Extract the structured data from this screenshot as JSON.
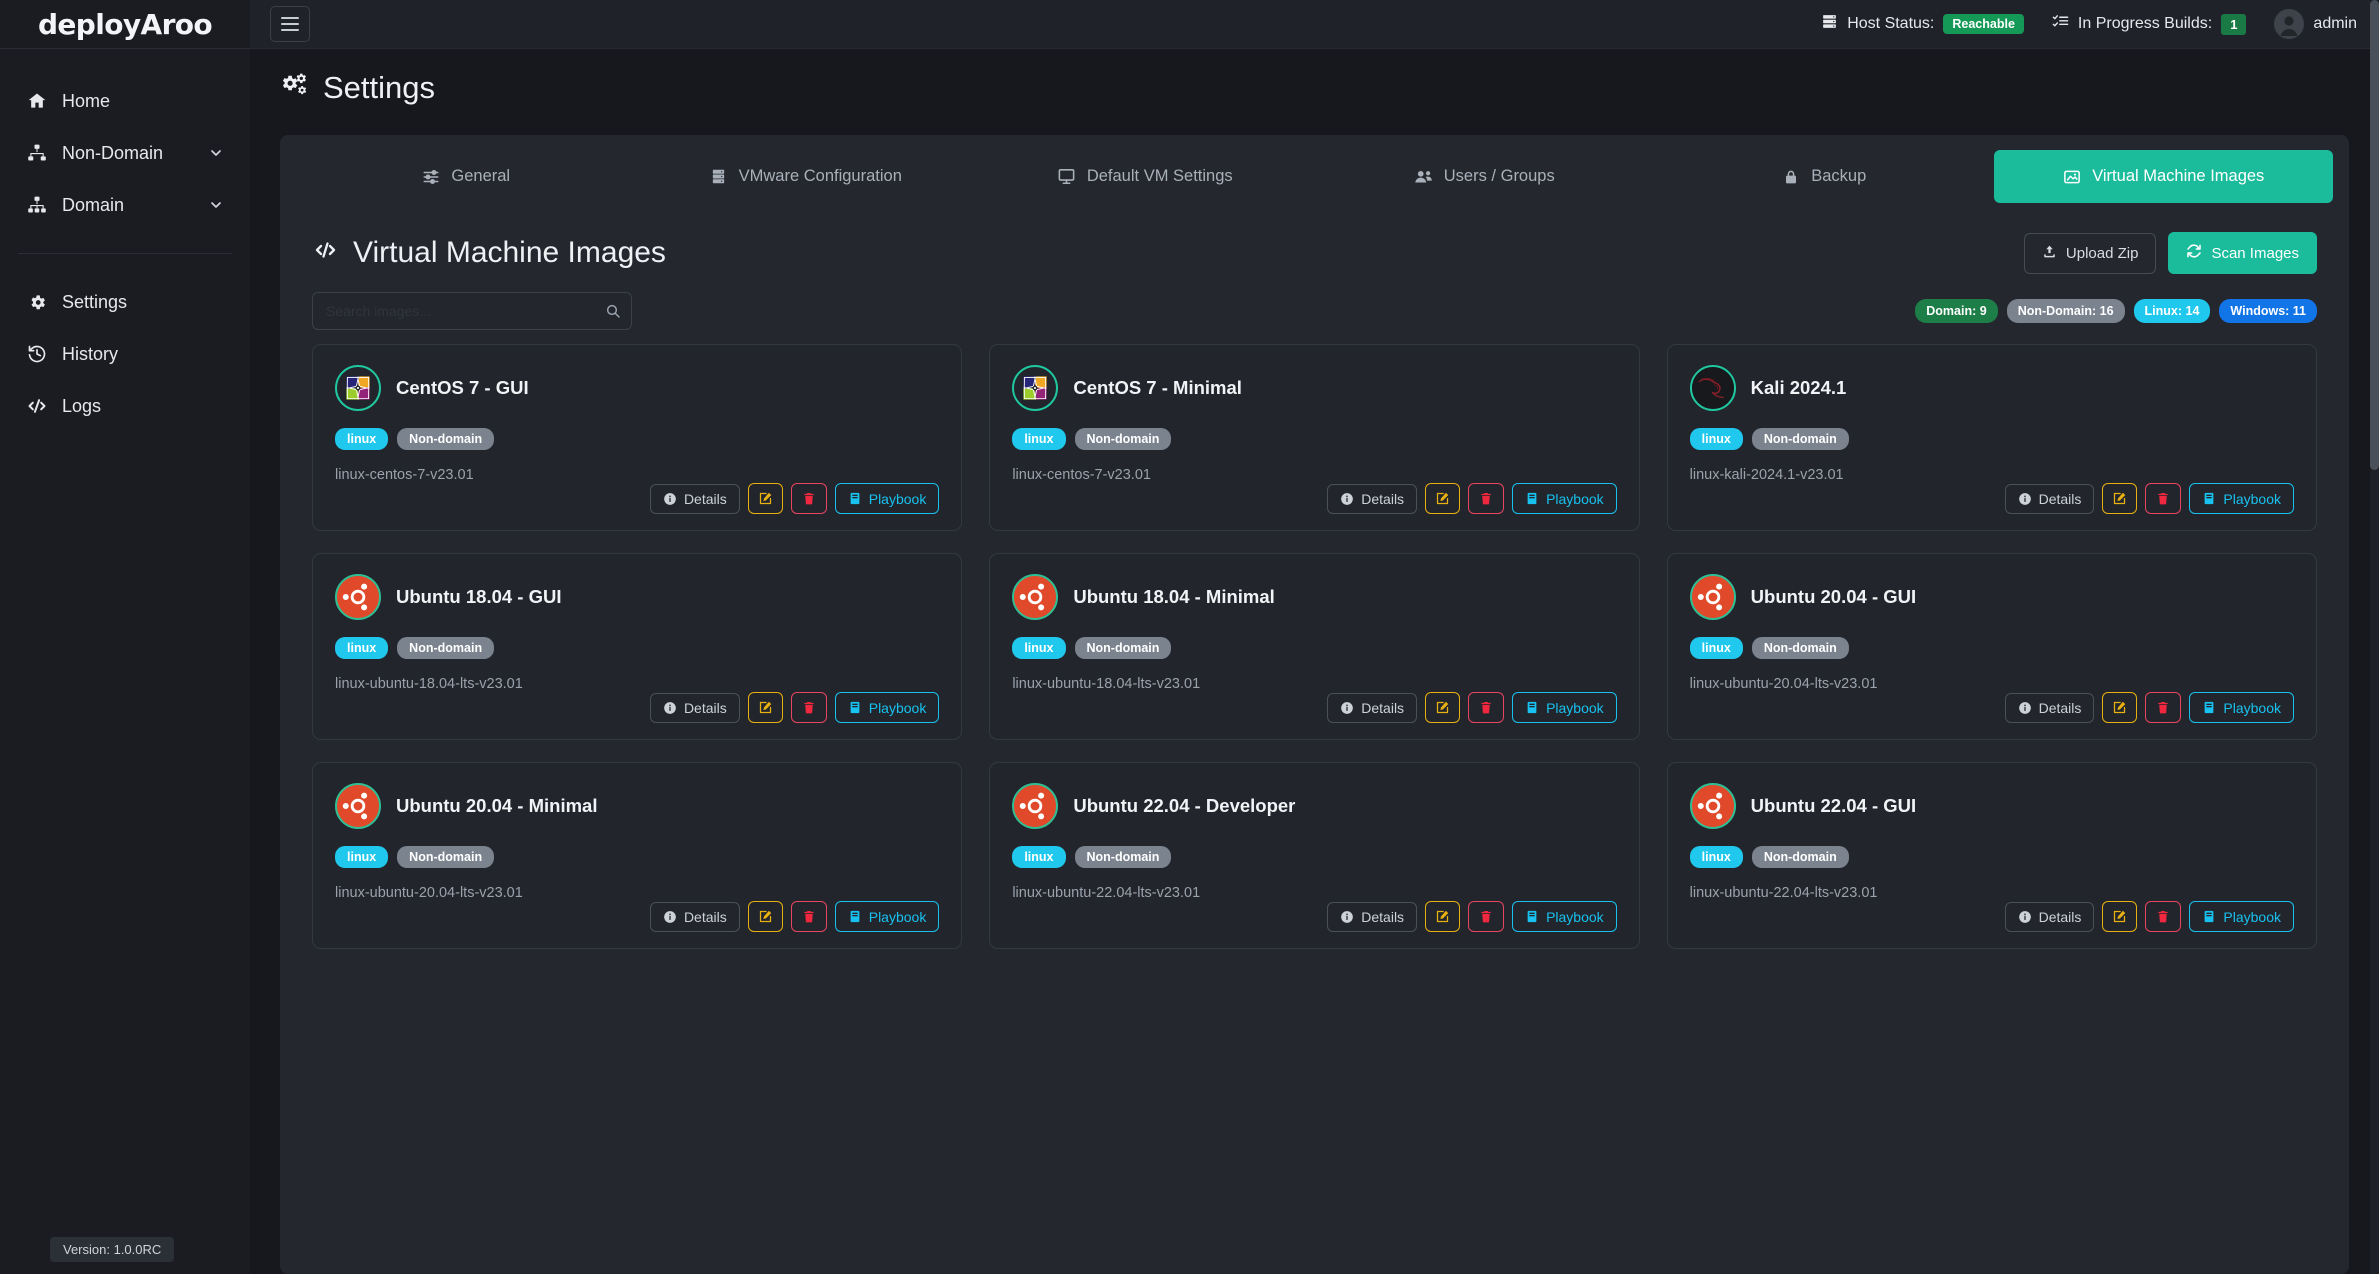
{
  "brand": {
    "name": "deployAroo"
  },
  "sidebar": {
    "items": [
      {
        "label": "Home",
        "icon": "home-icon",
        "expandable": false
      },
      {
        "label": "Non-Domain",
        "icon": "sitemap-icon",
        "expandable": true
      },
      {
        "label": "Domain",
        "icon": "sitemap-icon",
        "expandable": true
      }
    ],
    "items2": [
      {
        "label": "Settings",
        "icon": "gear-icon"
      },
      {
        "label": "History",
        "icon": "history-icon"
      },
      {
        "label": "Logs",
        "icon": "code-icon"
      }
    ],
    "version": "Version: 1.0.0RC"
  },
  "topbar": {
    "menu_icon": "hamburger-icon",
    "host_status_label": "Host Status:",
    "host_status_value": "Reachable",
    "builds_label": "In Progress Builds:",
    "builds_count": "1",
    "user": "admin"
  },
  "page": {
    "title": "Settings",
    "icon": "gears-icon"
  },
  "tabs": [
    {
      "label": "General",
      "icon": "sliders-icon",
      "active": false
    },
    {
      "label": "VMware Configuration",
      "icon": "server-icon",
      "active": false
    },
    {
      "label": "Default VM Settings",
      "icon": "desktop-icon",
      "active": false
    },
    {
      "label": "Users / Groups",
      "icon": "users-icon",
      "active": false
    },
    {
      "label": "Backup",
      "icon": "lock-icon",
      "active": false
    },
    {
      "label": "Virtual Machine Images",
      "icon": "image-icon",
      "active": true
    }
  ],
  "section": {
    "title": "Virtual Machine Images",
    "icon": "code-icon",
    "upload_label": "Upload Zip",
    "upload_icon": "upload-icon",
    "scan_label": "Scan Images",
    "scan_icon": "refresh-icon"
  },
  "search": {
    "value": "",
    "placeholder": "Search images...",
    "icon": "search-icon"
  },
  "badges": [
    {
      "label": "Domain: 9",
      "color": "#1e7e48"
    },
    {
      "label": "Non-Domain: 16",
      "color": "#7b838f"
    },
    {
      "label": "Linux: 14",
      "color": "#1fc8ec"
    },
    {
      "label": "Windows: 11",
      "color": "#1175e8"
    }
  ],
  "actions": {
    "details": "Details",
    "details_icon": "info-icon",
    "edit_icon": "pen-square-icon",
    "delete_icon": "trash-icon",
    "playbook": "Playbook",
    "playbook_icon": "book-icon"
  },
  "cards": [
    {
      "name": "CentOS 7 - GUI",
      "logo": "centos",
      "tags": [
        "linux",
        "Non-domain"
      ],
      "file": "linux-centos-7-v23.01"
    },
    {
      "name": "CentOS 7 - Minimal",
      "logo": "centos",
      "tags": [
        "linux",
        "Non-domain"
      ],
      "file": "linux-centos-7-v23.01"
    },
    {
      "name": "Kali 2024.1",
      "logo": "kali",
      "tags": [
        "linux",
        "Non-domain"
      ],
      "file": "linux-kali-2024.1-v23.01"
    },
    {
      "name": "Ubuntu 18.04 - GUI",
      "logo": "ubuntu",
      "tags": [
        "linux",
        "Non-domain"
      ],
      "file": "linux-ubuntu-18.04-lts-v23.01"
    },
    {
      "name": "Ubuntu 18.04 - Minimal",
      "logo": "ubuntu",
      "tags": [
        "linux",
        "Non-domain"
      ],
      "file": "linux-ubuntu-18.04-lts-v23.01"
    },
    {
      "name": "Ubuntu 20.04 - GUI",
      "logo": "ubuntu",
      "tags": [
        "linux",
        "Non-domain"
      ],
      "file": "linux-ubuntu-20.04-lts-v23.01"
    },
    {
      "name": "Ubuntu 20.04 - Minimal",
      "logo": "ubuntu",
      "tags": [
        "linux",
        "Non-domain"
      ],
      "file": "linux-ubuntu-20.04-lts-v23.01"
    },
    {
      "name": "Ubuntu 22.04 - Developer",
      "logo": "ubuntu",
      "tags": [
        "linux",
        "Non-domain"
      ],
      "file": "linux-ubuntu-22.04-lts-v23.01"
    },
    {
      "name": "Ubuntu 22.04 - GUI",
      "logo": "ubuntu",
      "tags": [
        "linux",
        "Non-domain"
      ],
      "file": "linux-ubuntu-22.04-lts-v23.01"
    }
  ]
}
